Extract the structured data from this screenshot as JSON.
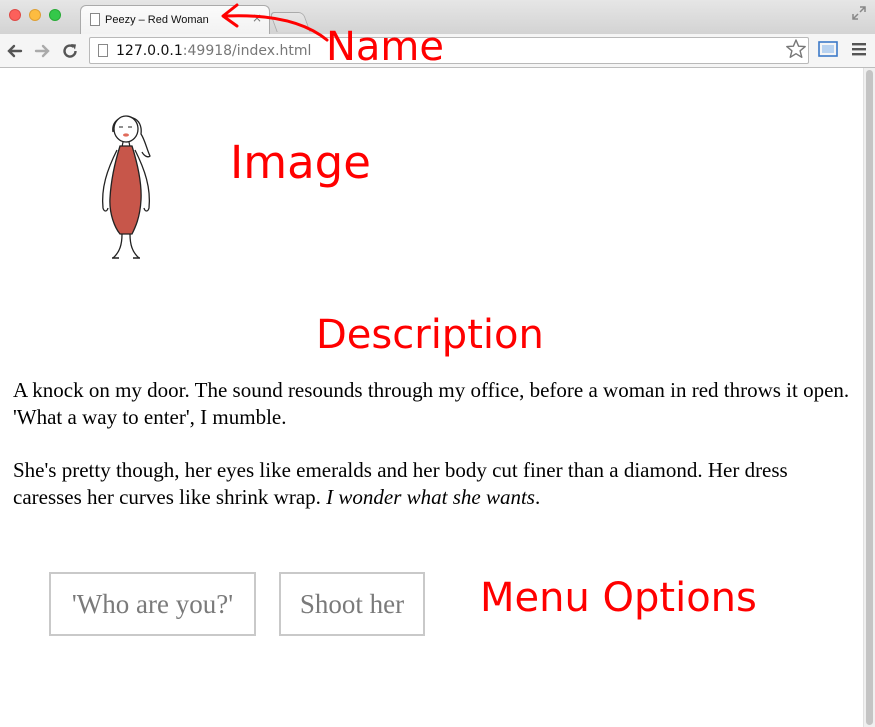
{
  "browser": {
    "tab_title": "Peezy – Red Woman",
    "tab_close": "×",
    "url_host": "127.0.0.1",
    "url_rest": ":49918/index.html"
  },
  "page": {
    "paragraphs": [
      "A knock on my door. The sound resounds through my office, before a woman in red throws it open. 'What a way to enter', I mumble.",
      "She's pretty though, her eyes like emeralds and her body cut finer than a diamond. Her dress caresses her curves like shrink wrap. "
    ],
    "paragraph2_italic": "I wonder what she wants",
    "paragraph2_end": ".",
    "options": [
      "'Who are you?'",
      "Shoot her"
    ],
    "character_dress_color": "#c7564a"
  },
  "annotations": {
    "name": "Name",
    "image": "Image",
    "description": "Description",
    "menu_options": "Menu Options",
    "color": "#ff0000"
  }
}
